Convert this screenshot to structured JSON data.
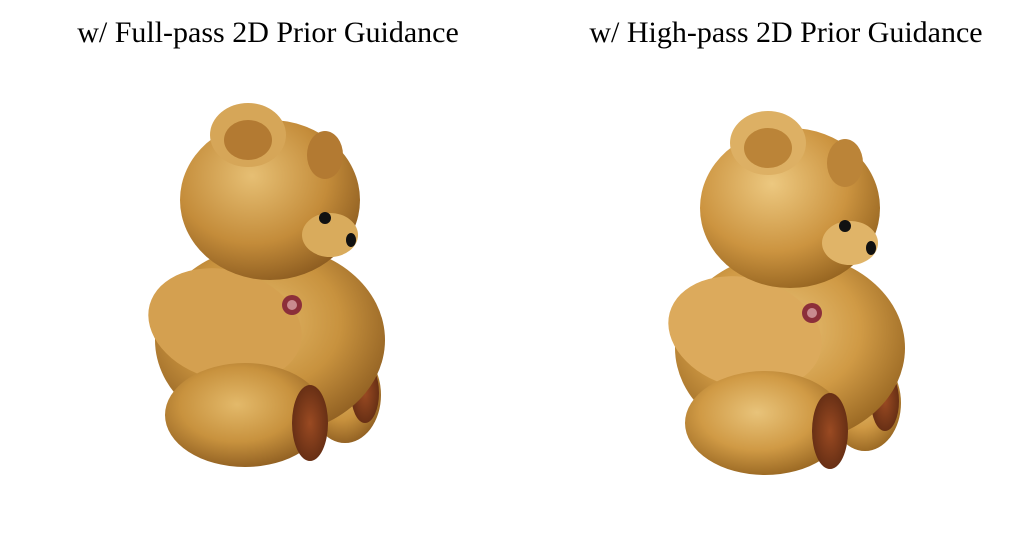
{
  "panels": [
    {
      "caption": "w/ Full-pass 2D Prior Guidance",
      "image": "teddy-bear-render-full-pass",
      "colors": {
        "fur": "#c8923e",
        "fur_light": "#e3b96a",
        "fur_dark": "#8a5a1f",
        "paw_pad": "#7a3a1c",
        "bow": "#8c2f3a",
        "eye": "#111111"
      }
    },
    {
      "caption": "w/ High-pass 2D Prior Guidance",
      "image": "teddy-bear-render-high-pass",
      "colors": {
        "fur": "#d09a45",
        "fur_light": "#e8c37a",
        "fur_dark": "#93621f",
        "paw_pad": "#7a3a1c",
        "bow": "#8c2f3a",
        "eye": "#111111"
      }
    }
  ]
}
